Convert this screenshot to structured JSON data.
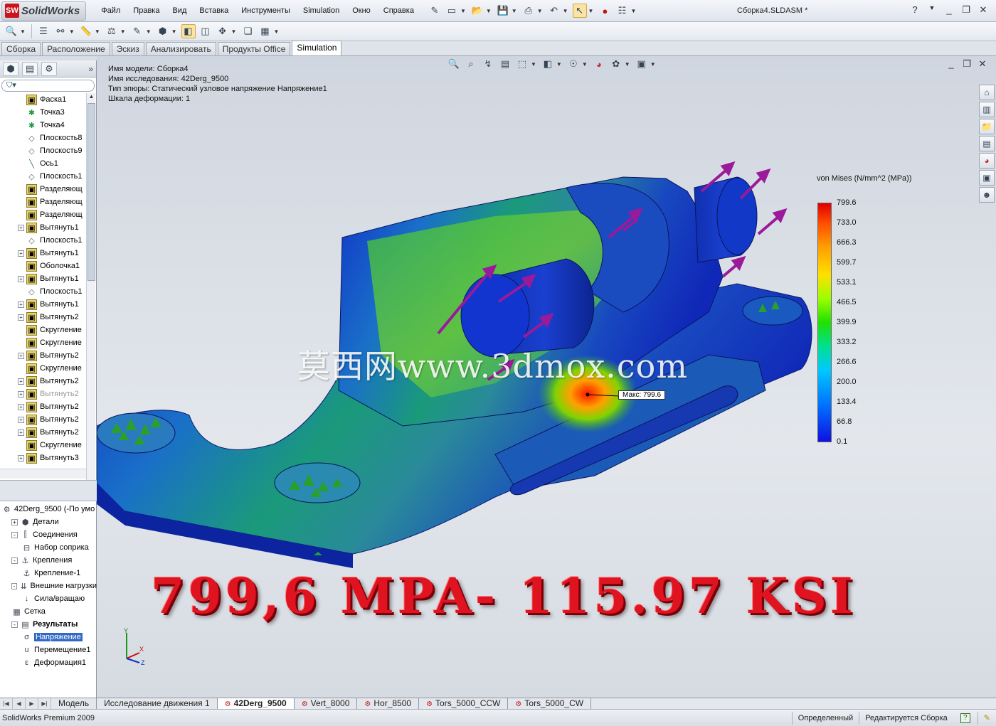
{
  "app": {
    "name": "SolidWorks",
    "badge": "SW",
    "document_title": "Сборка4.SLDASM *",
    "menu": [
      "Файл",
      "Правка",
      "Вид",
      "Вставка",
      "Инструменты",
      "Simulation",
      "Окно",
      "Справка"
    ]
  },
  "command_tabs": [
    {
      "label": "Сборка",
      "active": false
    },
    {
      "label": "Расположение",
      "active": false
    },
    {
      "label": "Эскиз",
      "active": false
    },
    {
      "label": "Анализировать",
      "active": false
    },
    {
      "label": "Продукты Office",
      "active": false
    },
    {
      "label": "Simulation",
      "active": true
    }
  ],
  "feature_tree": {
    "items": [
      {
        "label": "Фаска1",
        "icon": "feature-icon",
        "expandable": false
      },
      {
        "label": "Точка3",
        "icon": "point-icon",
        "expandable": false
      },
      {
        "label": "Точка4",
        "icon": "point-icon",
        "expandable": false
      },
      {
        "label": "Плоскость8",
        "icon": "plane-icon",
        "expandable": false
      },
      {
        "label": "Плоскость9",
        "icon": "plane-icon",
        "expandable": false
      },
      {
        "label": "Ось1",
        "icon": "axis-icon",
        "expandable": false
      },
      {
        "label": "Плоскость1",
        "icon": "plane-icon",
        "expandable": false
      },
      {
        "label": "Разделяющ",
        "icon": "feature-icon",
        "expandable": false
      },
      {
        "label": "Разделяющ",
        "icon": "feature-icon",
        "expandable": false
      },
      {
        "label": "Разделяющ",
        "icon": "feature-icon",
        "expandable": false
      },
      {
        "label": "Вытянуть1",
        "icon": "feature-icon",
        "expandable": true
      },
      {
        "label": "Плоскость1",
        "icon": "plane-icon",
        "expandable": false
      },
      {
        "label": "Вытянуть1",
        "icon": "feature-icon",
        "expandable": true
      },
      {
        "label": "Оболочка1",
        "icon": "feature-icon",
        "expandable": false
      },
      {
        "label": "Вытянуть1",
        "icon": "feature-icon",
        "expandable": true
      },
      {
        "label": "Плоскость1",
        "icon": "plane-icon",
        "expandable": false
      },
      {
        "label": "Вытянуть1",
        "icon": "feature-icon",
        "expandable": true
      },
      {
        "label": "Вытянуть2",
        "icon": "feature-icon",
        "expandable": true
      },
      {
        "label": "Скругление",
        "icon": "feature-icon",
        "expandable": false
      },
      {
        "label": "Скругление",
        "icon": "feature-icon",
        "expandable": false
      },
      {
        "label": "Вытянуть2",
        "icon": "feature-icon",
        "expandable": true
      },
      {
        "label": "Скругление",
        "icon": "feature-icon",
        "expandable": false
      },
      {
        "label": "Вытянуть2",
        "icon": "feature-icon",
        "expandable": true
      },
      {
        "label": "Вытянуть2",
        "icon": "feature-icon",
        "expandable": true,
        "dim": true
      },
      {
        "label": "Вытянуть2",
        "icon": "feature-icon",
        "expandable": true
      },
      {
        "label": "Вытянуть2",
        "icon": "feature-icon",
        "expandable": true
      },
      {
        "label": "Вытянуть2",
        "icon": "feature-icon",
        "expandable": true
      },
      {
        "label": "Скругление",
        "icon": "feature-icon",
        "expandable": false
      },
      {
        "label": "Вытянуть3",
        "icon": "feature-icon",
        "expandable": true
      }
    ]
  },
  "study_tree": {
    "items": [
      {
        "label": "42Derg_9500 (-По умо",
        "icon": "study-icon",
        "indent": 0,
        "expand": ""
      },
      {
        "label": "Детали",
        "icon": "parts-icon",
        "indent": 1,
        "expand": "+"
      },
      {
        "label": "Соединения",
        "icon": "connections-icon",
        "indent": 1,
        "expand": "-"
      },
      {
        "label": "Набор соприка",
        "icon": "contact-set-icon",
        "indent": 2,
        "expand": ""
      },
      {
        "label": "Крепления",
        "icon": "fixtures-icon",
        "indent": 1,
        "expand": "-"
      },
      {
        "label": "Крепление-1",
        "icon": "fixture-icon",
        "indent": 2,
        "expand": ""
      },
      {
        "label": "Внешние нагрузки",
        "icon": "loads-icon",
        "indent": 1,
        "expand": "-"
      },
      {
        "label": "Сила/вращаю",
        "icon": "force-icon",
        "indent": 2,
        "expand": ""
      },
      {
        "label": "Сетка",
        "icon": "mesh-icon",
        "indent": 1,
        "expand": ""
      },
      {
        "label": "Результаты",
        "icon": "results-icon",
        "indent": 1,
        "expand": "-",
        "bold": true
      },
      {
        "label": "Напряжение",
        "icon": "stress-plot-icon",
        "indent": 2,
        "expand": "",
        "selected": true
      },
      {
        "label": "Перемещение1",
        "icon": "displacement-plot-icon",
        "indent": 2,
        "expand": ""
      },
      {
        "label": "Деформация1",
        "icon": "strain-plot-icon",
        "indent": 2,
        "expand": ""
      }
    ]
  },
  "study_info": {
    "model_name": "Имя модели: Сборка4",
    "study_name": "Имя  исследования: 42Derg_9500",
    "plot_type": "Тип эпюры: Статический узловое напряжение Напряжение1",
    "deformation_scale": "Шкала деформации: 1"
  },
  "legend": {
    "title": "von Mises (N/mm^2 (MPa))",
    "values": [
      "799.6",
      "733.0",
      "666.3",
      "599.7",
      "533.1",
      "466.5",
      "399.9",
      "333.2",
      "266.6",
      "200.0",
      "133.4",
      "66.8",
      "0.1"
    ]
  },
  "max_callout": "Макс: 799.6",
  "watermark": "莫西网www.3dmox.com",
  "caption": "799,6 MPA- 115.97 KSI",
  "triad": {
    "x": "X",
    "y": "Y",
    "z": "Z"
  },
  "bottom_tabs": [
    {
      "label": "Модель",
      "active": false,
      "icon": false
    },
    {
      "label": "Исследование движения 1",
      "active": false,
      "icon": false
    },
    {
      "label": "42Derg_9500",
      "active": true,
      "icon": true
    },
    {
      "label": "Vert_8000",
      "active": false,
      "icon": true
    },
    {
      "label": "Hor_8500",
      "active": false,
      "icon": true
    },
    {
      "label": "Tors_5000_CCW",
      "active": false,
      "icon": true
    },
    {
      "label": "Tors_5000_CW",
      "active": false,
      "icon": true
    }
  ],
  "status": {
    "product": "SolidWorks Premium 2009",
    "state": "Определенный",
    "mode": "Редактируется Сборка",
    "help": "?"
  },
  "colors": {
    "accent_selection": "#316ac5",
    "stress_max": "#e00000",
    "stress_min": "#1010e0",
    "load_arrows": "#9a1a9a",
    "fixture_marks": "#2aa02a"
  }
}
